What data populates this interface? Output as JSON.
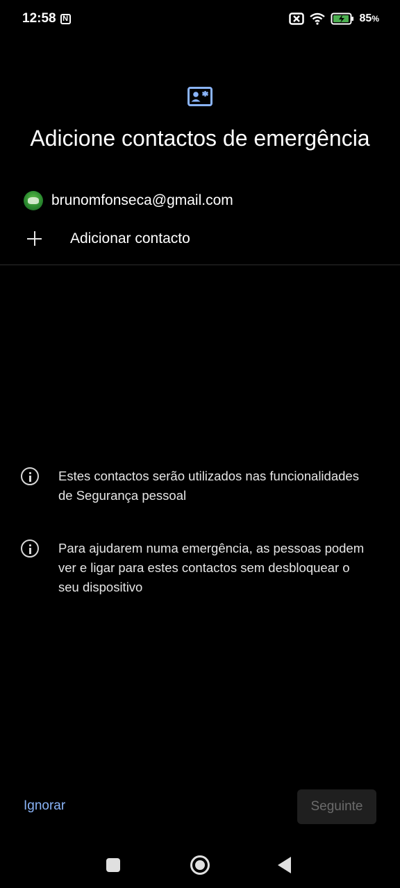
{
  "status_bar": {
    "time": "12:58",
    "nfc_label": "N",
    "battery_percent": "85",
    "battery_unit": "%"
  },
  "header": {
    "icon": "contact-card-icon",
    "title": "Adicione contactos de emergência"
  },
  "account": {
    "email": "brunomfonseca@gmail.com"
  },
  "add_contact": {
    "label": "Adicionar contacto"
  },
  "info": [
    {
      "icon": "info-icon",
      "text": "Estes contactos serão utilizados nas funcionalidades de Segurança pessoal"
    },
    {
      "icon": "info-icon",
      "text": "Para ajudarem numa emergência, as pessoas podem ver e ligar para estes contactos sem desbloquear o seu dispositivo"
    }
  ],
  "actions": {
    "ignore_label": "Ignorar",
    "next_label": "Seguinte"
  },
  "colors": {
    "accent": "#8ab4f8",
    "background": "#000000",
    "disabled_text": "#6b6b6b"
  }
}
